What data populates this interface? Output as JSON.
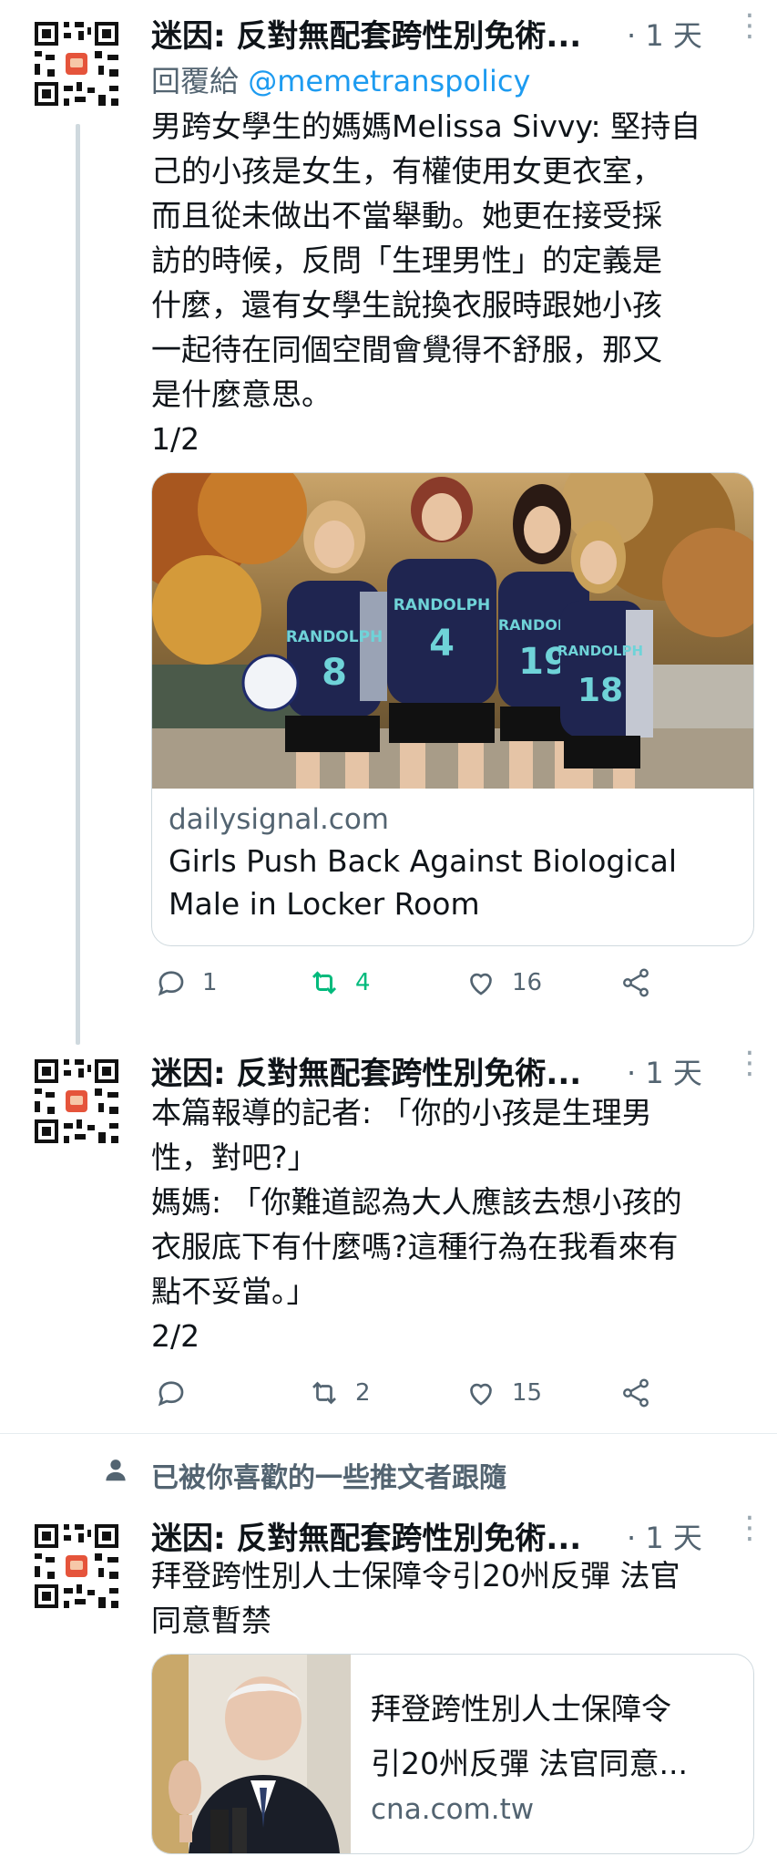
{
  "colors": {
    "accent": "#1d9bf0",
    "retweet_active": "#00ba7c",
    "muted": "#536471"
  },
  "tweets": [
    {
      "author": "迷因: 反對無配套跨性別免術...",
      "time": "· 1 天",
      "reply_prefix": "回覆給 ",
      "reply_handle": "@memetranspolicy",
      "text": "男跨女學生的媽媽Melissa Sivvy: 堅持自\n己的小孩是女生，有權使用女更衣室，\n而且從未做出不當舉動。她更在接受採\n訪的時候，反問「生理男性」的定義是\n什麼，還有女學生說換衣服時跟她小孩\n一起待在同個空間會覺得不舒服，那又\n是什麼意思。\n1/2",
      "card": {
        "domain": "dailysignal.com",
        "title": "Girls Push Back Against Biological\nMale in Locker Room",
        "jerseys": [
          "RANDOLPH",
          "8",
          "RANDOLPH",
          "4",
          "RANDOLPH",
          "19",
          "RANDOLPH",
          "18"
        ]
      },
      "actions": {
        "replies": "1",
        "retweets": "4",
        "likes": "16",
        "retweeted": true
      }
    },
    {
      "author": "迷因: 反對無配套跨性別免術...",
      "time": "· 1 天",
      "text": "本篇報導的記者: 「你的小孩是生理男\n性，對吧?」\n媽媽: 「你難道認為大人應該去想小孩的\n衣服底下有什麼嗎?這種行為在我看來有\n點不妥當。」\n2/2",
      "actions": {
        "replies": "",
        "retweets": "2",
        "likes": "15",
        "retweeted": false
      }
    },
    {
      "social_context": "已被你喜歡的一些推文者跟隨",
      "author": "迷因: 反對無配套跨性別免術...",
      "time": "· 1 天",
      "text": "拜登跨性別人士保障令引20州反彈 法官\n同意暫禁",
      "card": {
        "title": "拜登跨性別人士保障令\n引20州反彈 法官同意...",
        "domain": "cna.com.tw"
      }
    }
  ]
}
